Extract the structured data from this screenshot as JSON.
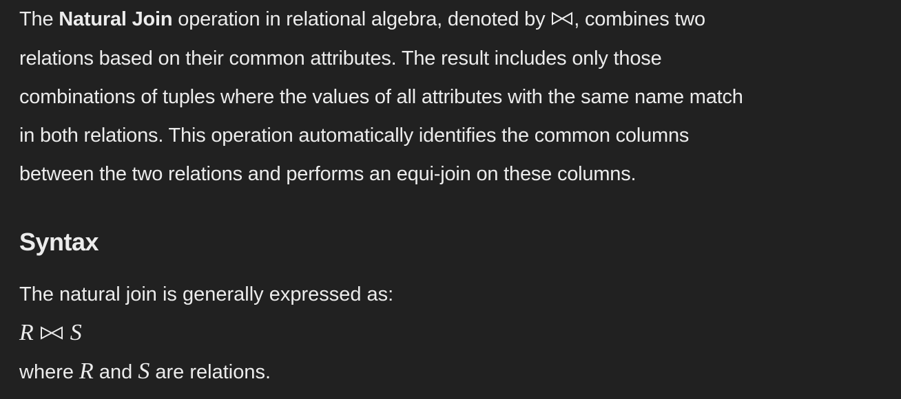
{
  "intro": {
    "line1_pre": "The ",
    "line1_bold": "Natural Join",
    "line1_mid": " operation in relational algebra, denoted by ",
    "line1_post": ", combines two",
    "line2": "relations based on their common attributes. The result includes only those",
    "line3": "combinations of tuples where the values of all attributes with the same name match",
    "line4": "in both relations. This operation automatically identifies the common columns",
    "line5": "between the two relations and performs an equi-join on these columns."
  },
  "syntax": {
    "heading": "Syntax",
    "lead": "The natural join is generally expressed as:",
    "formula_left": "R",
    "formula_right": "S",
    "where_pre": "where ",
    "where_var1": "R",
    "where_mid": " and ",
    "where_var2": "S",
    "where_post": " are relations."
  },
  "icons": {
    "join_symbol": "bowtie-icon"
  }
}
